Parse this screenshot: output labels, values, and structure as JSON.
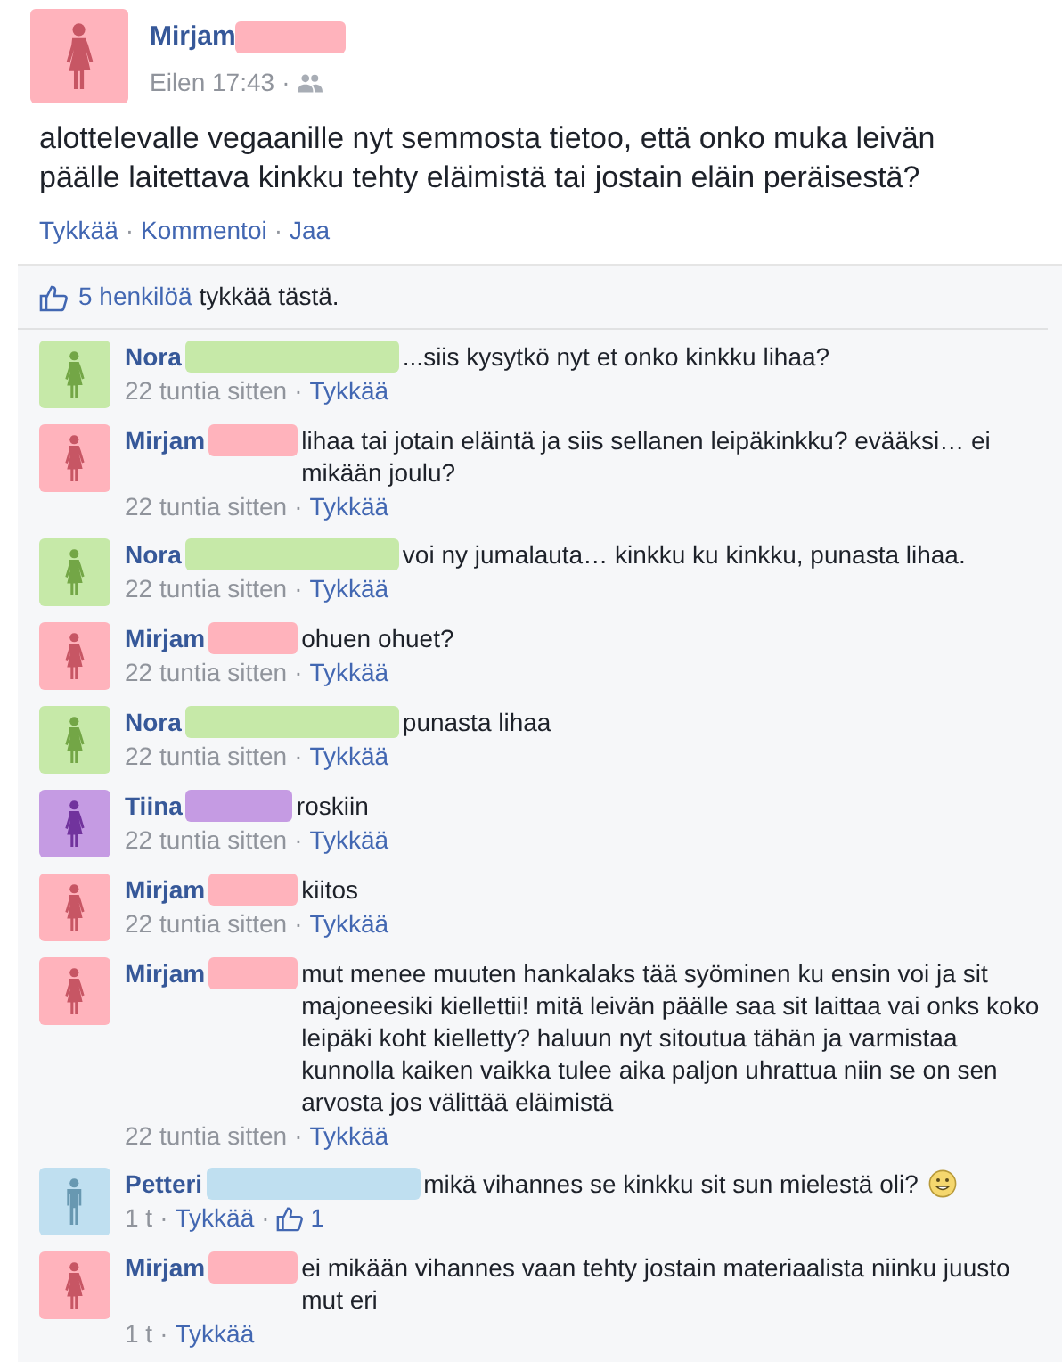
{
  "post": {
    "author": {
      "name": "Mirjam",
      "kind": "female",
      "color": "#ffb3bc"
    },
    "time": "Eilen 17:43",
    "separator": "·",
    "text": "alottelevalle vegaanille nyt semmosta tietoo, että onko muka leivän päälle laitettava kinkku tehty eläimistä tai jostain eläin peräisestä?",
    "actions": [
      "Tykkää",
      "Kommentoi",
      "Jaa"
    ],
    "likes": {
      "count": "5 henkilöä",
      "text": "tykkää tästä."
    }
  },
  "comments": [
    {
      "name": "Nora",
      "kind": "female",
      "color": "#c6e9a8",
      "text": "...siis kysytkö nyt et onko kinkku lihaa?",
      "time": "22 tuntia sitten",
      "like": "Tykkää"
    },
    {
      "name": "Mirjam",
      "kind": "female",
      "color": "#ffb3bc",
      "text": "lihaa tai jotain eläintä ja siis sellanen leipäkinkku? evääksi… ei mikään joulu?",
      "time": "22 tuntia sitten",
      "like": "Tykkää"
    },
    {
      "name": "Nora",
      "kind": "female",
      "color": "#c6e9a8",
      "text": "voi ny jumalauta… kinkku ku kinkku, punasta lihaa.",
      "time": "22 tuntia sitten",
      "like": "Tykkää"
    },
    {
      "name": "Mirjam",
      "kind": "female",
      "color": "#ffb3bc",
      "text": "ohuen ohuet?",
      "time": "22 tuntia sitten",
      "like": "Tykkää"
    },
    {
      "name": "Nora",
      "kind": "female",
      "color": "#c6e9a8",
      "text": "punasta lihaa",
      "time": "22 tuntia sitten",
      "like": "Tykkää"
    },
    {
      "name": "Tiina",
      "kind": "female",
      "color": "#c59be3",
      "text": "roskiin",
      "time": "22 tuntia sitten",
      "like": "Tykkää"
    },
    {
      "name": "Mirjam",
      "kind": "female",
      "color": "#ffb3bc",
      "text": "kiitos",
      "time": "22 tuntia sitten",
      "like": "Tykkää"
    },
    {
      "name": "Mirjam",
      "kind": "female",
      "color": "#ffb3bc",
      "text": "mut menee muuten hankalaks tää syöminen ku ensin voi ja sit majoneesiki kiellettii! mitä leivän päälle saa sit laittaa vai onks koko leipäki koht kielletty? haluun nyt sitoutua tähän ja varmistaa kunnolla kaiken vaikka tulee aika paljon uhrattua niin se on sen arvosta jos välittää eläimistä",
      "time": "22 tuntia sitten",
      "like": "Tykkää"
    },
    {
      "name": "Petteri",
      "kind": "male",
      "color": "#bfdff0",
      "text": "mikä vihannes se kinkku sit sun mielestä oli?",
      "smiley": true,
      "time": "1 t",
      "like": "Tykkää",
      "like_count": "1"
    },
    {
      "name": "Mirjam",
      "kind": "female",
      "color": "#ffb3bc",
      "text": "ei mikään vihannes vaan tehty jostain materiaalista niinku juusto mut eri",
      "time": "1 t",
      "like": "Tykkää"
    }
  ]
}
